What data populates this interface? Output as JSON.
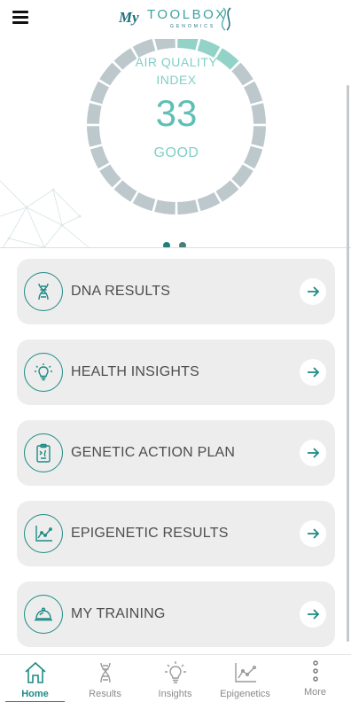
{
  "header": {
    "menu_icon": "hamburger-menu-icon",
    "logo": {
      "script": "My",
      "word": "TOOLBOX",
      "sub": "GENOMICS"
    }
  },
  "hero": {
    "aqi_label_line1": "AIR QUALITY",
    "aqi_label_line2": "INDEX",
    "aqi_value": "33",
    "aqi_status": "GOOD",
    "gauge_level": 0.12,
    "colors": {
      "gauge_fill": "#93d3c7",
      "gauge_base": "#bcc8cc",
      "accent": "#5fbfb4"
    },
    "carousel_pages": 2,
    "carousel_active": 1
  },
  "menu": [
    {
      "label": "DNA RESULTS",
      "icon": "dna-icon"
    },
    {
      "label": "HEALTH INSIGHTS",
      "icon": "lightbulb-icon"
    },
    {
      "label": "GENETIC ACTION PLAN",
      "icon": "clipboard-icon"
    },
    {
      "label": "EPIGENETIC RESULTS",
      "icon": "line-chart-icon"
    },
    {
      "label": "MY TRAINING",
      "icon": "cloche-icon"
    }
  ],
  "nav": [
    {
      "label": "Home",
      "icon": "home-icon",
      "active": true
    },
    {
      "label": "Results",
      "icon": "dna-icon",
      "active": false
    },
    {
      "label": "Insights",
      "icon": "lightbulb-icon",
      "active": false
    },
    {
      "label": "Epigenetics",
      "icon": "line-chart-icon",
      "active": false
    },
    {
      "label": "More",
      "icon": "more-vertical-icon",
      "active": false
    }
  ],
  "theme": {
    "primary": "#1f8a85",
    "card_bg": "#ededed",
    "text": "#4d4d4d"
  }
}
